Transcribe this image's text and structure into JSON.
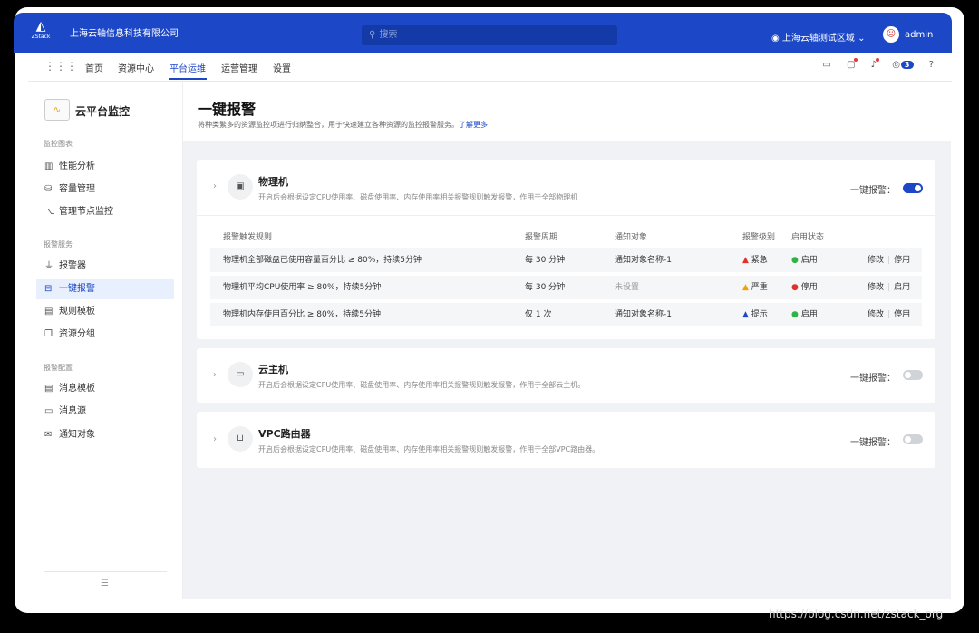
{
  "topbar": {
    "logo_text": "ZStack",
    "company": "上海云轴信息科技有限公司",
    "search_placeholder": "搜索",
    "region": "上海云轴测试区域",
    "user": "admin"
  },
  "nav": {
    "items": [
      "首页",
      "资源中心",
      "平台运维",
      "运营管理",
      "设置"
    ],
    "active_index": 2,
    "badge_count": "3"
  },
  "sidebar": {
    "app_title": "云平台监控",
    "groups": [
      {
        "title": "监控图表",
        "items": [
          {
            "icon": "bar-chart-icon",
            "label": "性能分析"
          },
          {
            "icon": "database-icon",
            "label": "容量管理"
          },
          {
            "icon": "nodes-icon",
            "label": "管理节点监控"
          }
        ]
      },
      {
        "title": "报警服务",
        "items": [
          {
            "icon": "alarm-icon",
            "label": "报警器"
          },
          {
            "icon": "one-click-alarm-icon",
            "label": "一键报警"
          },
          {
            "icon": "template-icon",
            "label": "规则模板"
          },
          {
            "icon": "group-icon",
            "label": "资源分组"
          }
        ]
      },
      {
        "title": "报警配置",
        "items": [
          {
            "icon": "message-template-icon",
            "label": "消息模板"
          },
          {
            "icon": "message-source-icon",
            "label": "消息源"
          },
          {
            "icon": "notify-target-icon",
            "label": "通知对象"
          }
        ]
      }
    ]
  },
  "page": {
    "title": "一键报警",
    "desc": "将种类繁多的资源监控项进行归纳整合，用于快速建立各种资源的监控报警服务。",
    "learn_more": "了解更多"
  },
  "cards": [
    {
      "name": "物理机",
      "desc": "开启后会根据设定CPU使用率、磁盘使用率、内存使用率相关报警规则触发报警，作用于全部物理机",
      "toggle_label": "一键报警：",
      "enabled": true,
      "headers": [
        "报警触发规则",
        "报警周期",
        "通知对象",
        "报警级别",
        "启用状态"
      ],
      "rows": [
        {
          "rule": "物理机全部磁盘已使用容量百分比 ≥ 80%，持续5分钟",
          "period": "每 30 分钟",
          "target": "通知对象名称-1",
          "level": "紧急",
          "status": "启用",
          "action1": "修改",
          "action2": "停用"
        },
        {
          "rule": "物理机平均CPU使用率 ≥ 80%，持续5分钟",
          "period": "每 30 分钟",
          "target": "未设置",
          "level": "严重",
          "status": "停用",
          "action1": "修改",
          "action2": "启用"
        },
        {
          "rule": "物理机内存使用百分比 ≥ 80%，持续5分钟",
          "period": "仅 1 次",
          "target": "通知对象名称-1",
          "level": "提示",
          "status": "启用",
          "action1": "修改",
          "action2": "停用"
        }
      ]
    },
    {
      "name": "云主机",
      "desc": "开启后会根据设定CPU使用率、磁盘使用率、内存使用率相关报警规则触发报警，作用于全部云主机。",
      "toggle_label": "一键报警：",
      "enabled": false
    },
    {
      "name": "VPC路由器",
      "desc": "开启后会根据设定CPU使用率、磁盘使用率、内存使用率相关报警规则触发报警，作用于全部VPC路由器。",
      "toggle_label": "一键报警：",
      "enabled": false
    }
  ],
  "watermark": "https://blog.csdn.net/zstack_org"
}
